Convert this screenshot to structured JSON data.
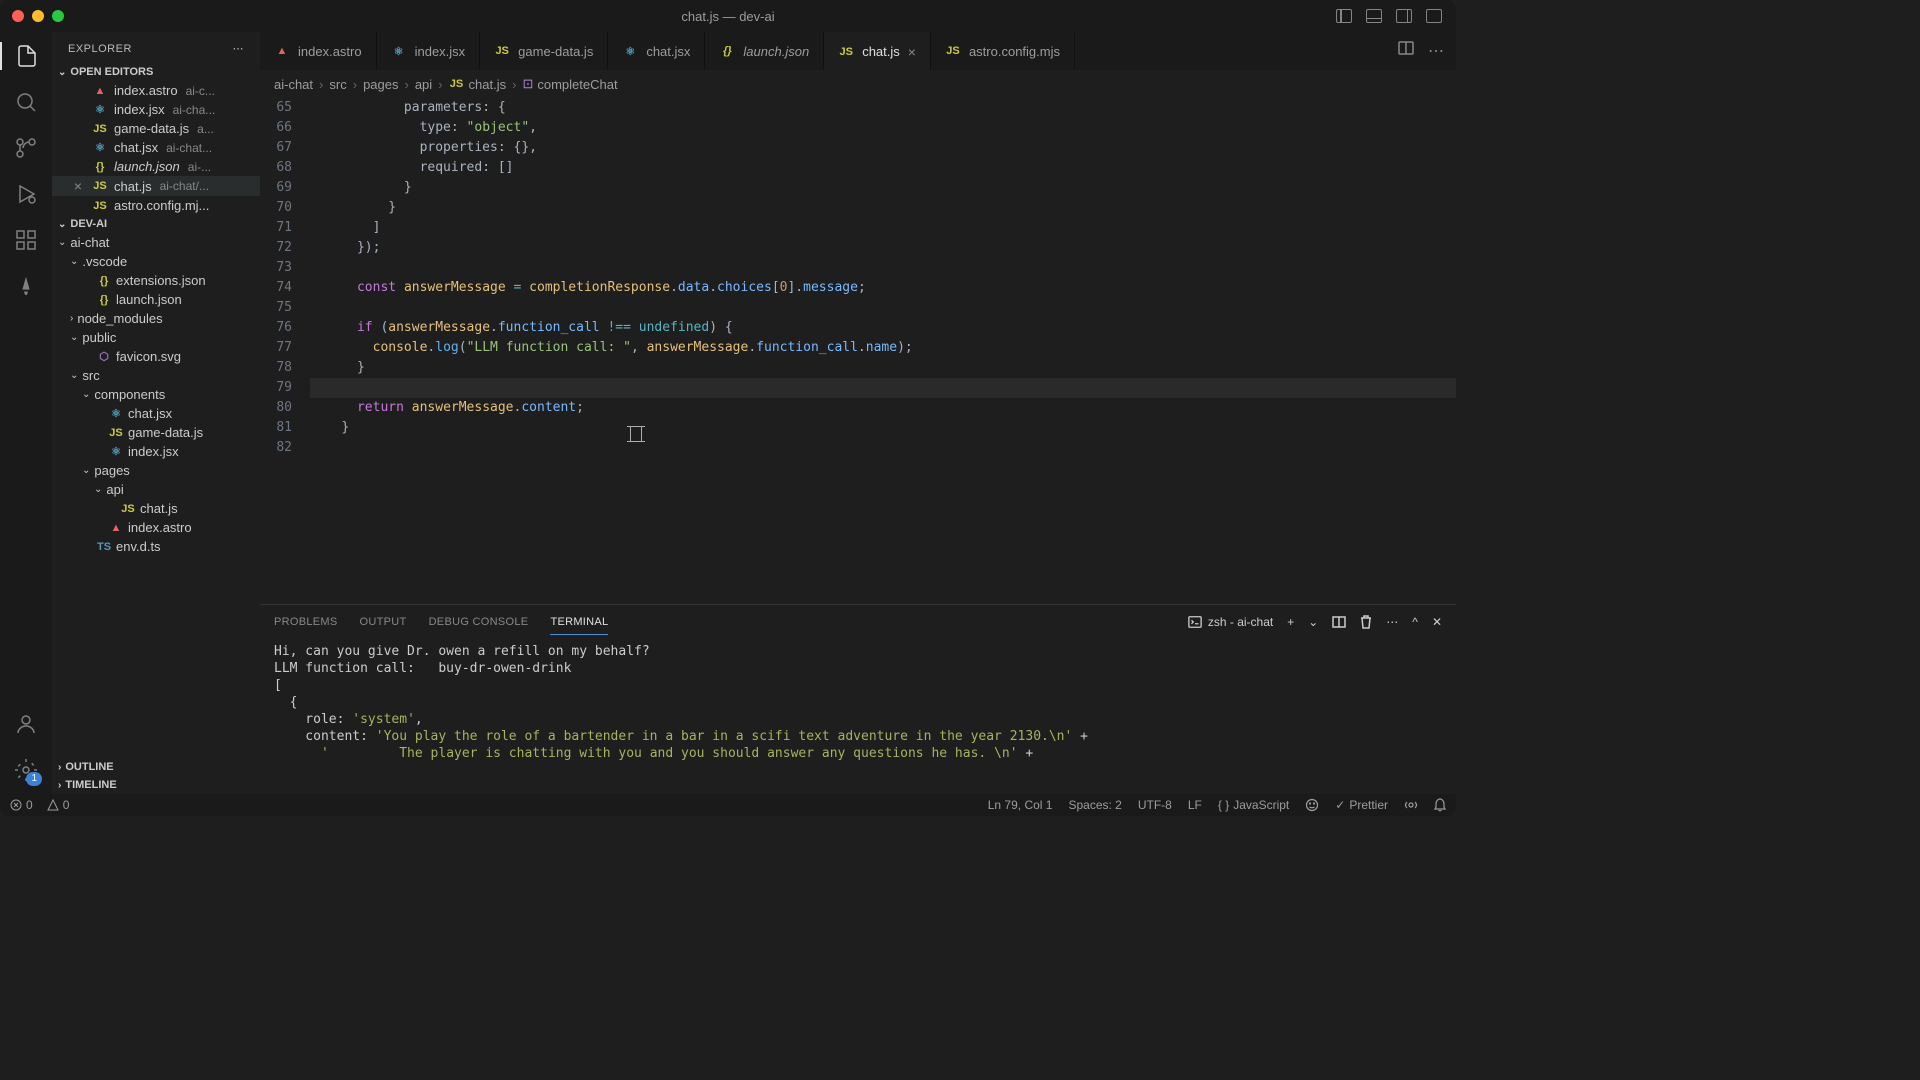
{
  "window": {
    "title": "chat.js — dev-ai"
  },
  "sidebar": {
    "title": "EXPLORER",
    "sections": {
      "openEditors": "OPEN EDITORS",
      "workspace": "DEV-AI",
      "outline": "OUTLINE",
      "timeline": "TIMELINE"
    }
  },
  "openEditors": [
    {
      "name": "index.astro",
      "path": "ai-c...",
      "icon": "astro"
    },
    {
      "name": "index.jsx",
      "path": "ai-cha...",
      "icon": "jsx"
    },
    {
      "name": "game-data.js",
      "path": "a...",
      "icon": "js"
    },
    {
      "name": "chat.jsx",
      "path": "ai-chat...",
      "icon": "jsx"
    },
    {
      "name": "launch.json",
      "path": "ai-...",
      "icon": "json",
      "italic": true
    },
    {
      "name": "chat.js",
      "path": "ai-chat/...",
      "icon": "js",
      "active": true
    },
    {
      "name": "astro.config.mj...",
      "path": "",
      "icon": "js"
    }
  ],
  "tree": {
    "root": "ai-chat",
    "vscode": ".vscode",
    "vscodeItems": [
      "extensions.json",
      "launch.json"
    ],
    "nodeModules": "node_modules",
    "public": "public",
    "publicItems": [
      "favicon.svg"
    ],
    "src": "src",
    "components": "components",
    "componentsItems": [
      "chat.jsx",
      "game-data.js",
      "index.jsx"
    ],
    "pages": "pages",
    "api": "api",
    "apiItems": [
      "chat.js"
    ],
    "pagesItems": [
      "index.astro"
    ],
    "envd": "env.d.ts"
  },
  "tabs": [
    {
      "label": "index.astro",
      "icon": "astro"
    },
    {
      "label": "index.jsx",
      "icon": "jsx"
    },
    {
      "label": "game-data.js",
      "icon": "js"
    },
    {
      "label": "chat.jsx",
      "icon": "jsx"
    },
    {
      "label": "launch.json",
      "icon": "json",
      "italic": true
    },
    {
      "label": "chat.js",
      "icon": "js",
      "active": true
    },
    {
      "label": "astro.config.mjs",
      "icon": "js"
    }
  ],
  "breadcrumb": [
    "ai-chat",
    "src",
    "pages",
    "api",
    "chat.js",
    "completeChat"
  ],
  "code": {
    "startLine": 65,
    "lines": [
      {
        "n": 65,
        "html": "            parameters<span class='tok-punc'>:</span> <span class='tok-punc'>{</span>"
      },
      {
        "n": 66,
        "html": "              type<span class='tok-punc'>:</span> <span class='tok-str'>\"object\"</span><span class='tok-punc'>,</span>"
      },
      {
        "n": 67,
        "html": "              properties<span class='tok-punc'>:</span> <span class='tok-punc'>{},</span>"
      },
      {
        "n": 68,
        "html": "              required<span class='tok-punc'>:</span> <span class='tok-punc'>[]</span>"
      },
      {
        "n": 69,
        "html": "            <span class='tok-punc'>}</span>"
      },
      {
        "n": 70,
        "html": "          <span class='tok-punc'>}</span>"
      },
      {
        "n": 71,
        "html": "        <span class='tok-punc'>]</span>"
      },
      {
        "n": 72,
        "html": "      <span class='tok-punc'>});</span>"
      },
      {
        "n": 73,
        "html": ""
      },
      {
        "n": 74,
        "html": "      <span class='tok-key'>const</span> <span class='tok-var'>answerMessage</span> <span class='tok-op'>=</span> <span class='tok-var'>completionResponse</span><span class='tok-punc'>.</span><span class='tok-prop'>data</span><span class='tok-punc'>.</span><span class='tok-prop'>choices</span><span class='tok-punc'>[</span><span class='tok-num'>0</span><span class='tok-punc'>].</span><span class='tok-prop'>message</span><span class='tok-punc'>;</span>"
      },
      {
        "n": 75,
        "html": ""
      },
      {
        "n": 76,
        "html": "      <span class='tok-key'>if</span> <span class='tok-punc'>(</span><span class='tok-var'>answerMessage</span><span class='tok-punc'>.</span><span class='tok-prop'>function_call</span> <span class='tok-op'>!==</span> <span class='tok-const'>undefined</span><span class='tok-punc'>) {</span>"
      },
      {
        "n": 77,
        "html": "        <span class='tok-var'>console</span><span class='tok-punc'>.</span><span class='tok-fn'>log</span><span class='tok-punc'>(</span><span class='tok-str'>\"LLM function call: \"</span><span class='tok-punc'>,</span> <span class='tok-var'>answerMessage</span><span class='tok-punc'>.</span><span class='tok-prop'>function_call</span><span class='tok-punc'>.</span><span class='tok-prop'>name</span><span class='tok-punc'>);</span>"
      },
      {
        "n": 78,
        "html": "      <span class='tok-punc'>}</span>"
      },
      {
        "n": 79,
        "html": "",
        "hl": true
      },
      {
        "n": 80,
        "html": "      <span class='tok-key'>return</span> <span class='tok-var'>answerMessage</span><span class='tok-punc'>.</span><span class='tok-prop'>content</span><span class='tok-punc'>;</span>"
      },
      {
        "n": 81,
        "html": "    <span class='tok-punc'>}</span>"
      },
      {
        "n": 82,
        "html": ""
      }
    ]
  },
  "panel": {
    "tabs": [
      "PROBLEMS",
      "OUTPUT",
      "DEBUG CONSOLE",
      "TERMINAL"
    ],
    "activeTab": 3,
    "shell": "zsh - ai-chat",
    "lines": [
      "Hi, can you give Dr. owen a refill on my behalf?",
      "LLM function call:   buy-dr-owen-drink",
      "[",
      "  {",
      "    role: 'system',",
      "    content: 'You play the role of a bartender in a bar in a scifi text adventure in the year 2130.\\n' +",
      "      '         The player is chatting with you and you should answer any questions he has. \\n' +"
    ]
  },
  "status": {
    "errors": "0",
    "warnings": "0",
    "cursor": "Ln 79, Col 1",
    "spaces": "Spaces: 2",
    "encoding": "UTF-8",
    "eol": "LF",
    "lang": "JavaScript",
    "prettier": "Prettier",
    "badge": "1"
  }
}
